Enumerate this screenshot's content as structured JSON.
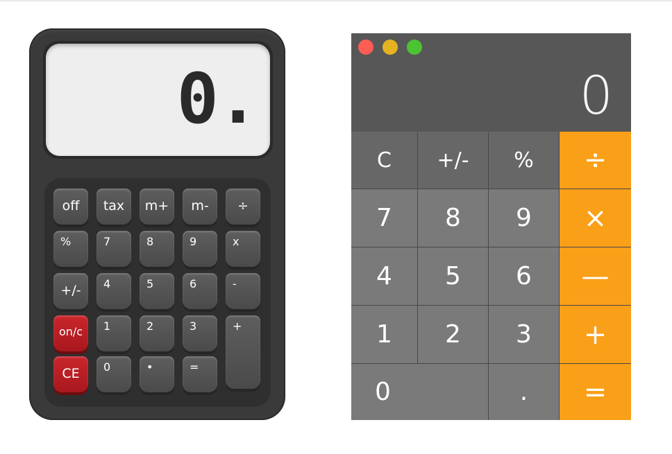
{
  "physical_calculator": {
    "display": "0.",
    "keys": {
      "off": "off",
      "tax": "tax",
      "m_plus": "m+",
      "m_minus": "m-",
      "divide": "÷",
      "percent": "%",
      "k7": "7",
      "k8": "8",
      "k9": "9",
      "multiply": "x",
      "plus_minus": "+/-",
      "k4": "4",
      "k5": "5",
      "k6": "6",
      "minus": "-",
      "on_c": "on/c",
      "k1": "1",
      "k2": "2",
      "k3": "3",
      "plus": "+",
      "ce": "CE",
      "k0": "0",
      "dot": "•",
      "equals": "="
    },
    "colors": {
      "body": "#3a3a3a",
      "key": "#555555",
      "red_key": "#b81e24",
      "lcd": "#eeeeee"
    }
  },
  "mac_calculator": {
    "display": "0",
    "traffic_lights": [
      "close",
      "minimize",
      "zoom"
    ],
    "keys": {
      "clear": "C",
      "plus_minus": "+/-",
      "percent": "%",
      "divide": "÷",
      "k7": "7",
      "k8": "8",
      "k9": "9",
      "multiply": "×",
      "k4": "4",
      "k5": "5",
      "k6": "6",
      "minus": "—",
      "k1": "1",
      "k2": "2",
      "k3": "3",
      "plus": "+",
      "k0": "0",
      "dot": ".",
      "equals": "="
    },
    "colors": {
      "operator": "#f99f18",
      "function": "#676767",
      "number": "#7a7a7a",
      "display_bg": "#575757"
    }
  }
}
